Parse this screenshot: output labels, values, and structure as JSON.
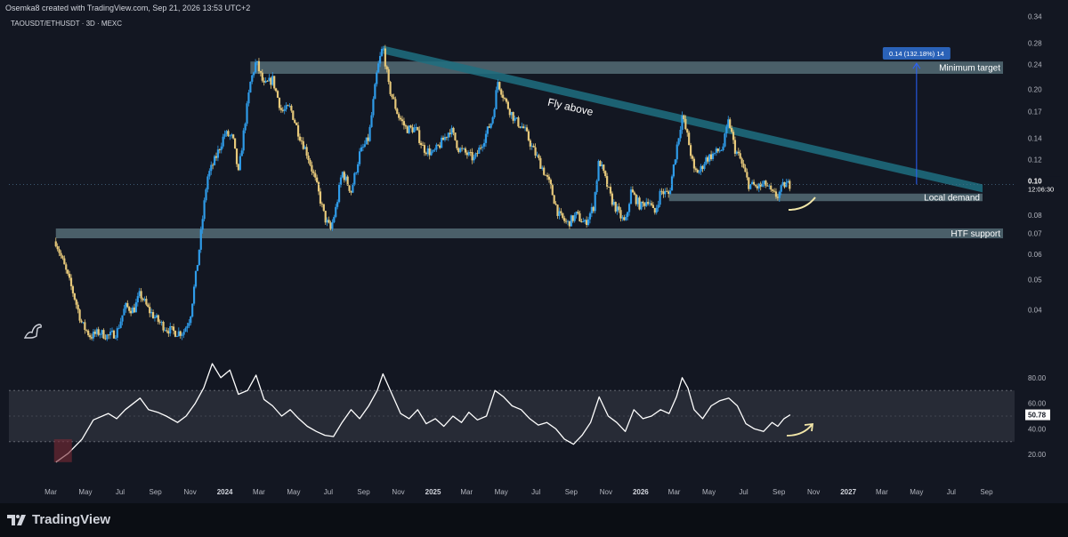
{
  "header": {
    "attribution": "Osemka8 created with TradingView.com, Sep 21, 2026 13:53 UTC+2",
    "symbol": "TAOUSDT/ETHUSDT · 3D · MEXC"
  },
  "footer": {
    "brand": "TradingView"
  },
  "colors": {
    "background": "#131722",
    "candle_up": "#2f9be8",
    "candle_down": "#e6c87a",
    "zone": "#8fb7c2",
    "trendline": "#1f6f80",
    "target_box": "#2a62b8",
    "rsi_line": "#ffffff",
    "rsi_band": "#2a2e39"
  },
  "chart_data": [
    {
      "type": "candlestick",
      "title": "TAOUSDT/ETHUSDT · 3D · MEXC",
      "x_axis_labels": [
        "Mar",
        "May",
        "Jul",
        "Sep",
        "Nov",
        "2024",
        "Mar",
        "May",
        "Jul",
        "Sep",
        "Nov",
        "2025",
        "Mar",
        "May",
        "Jul",
        "Sep",
        "Nov",
        "2026",
        "Mar",
        "May",
        "Jul",
        "Sep",
        "Nov",
        "2027",
        "Mar",
        "May",
        "Jul",
        "Sep"
      ],
      "y_axis_labels": [
        "0.34",
        "0.28",
        "0.24",
        "0.20",
        "0.17",
        "0.14",
        "0.12",
        "0.10",
        "0.08",
        "0.07",
        "0.06",
        "0.05",
        "0.04"
      ],
      "y_scale": "log",
      "ylim": [
        0.031,
        0.355
      ],
      "current_price": {
        "label": "0.10",
        "countdown": "12:06:30"
      },
      "close_path": [
        [
          "2023-03-10",
          0.066
        ],
        [
          "2023-03-25",
          0.055
        ],
        [
          "2023-04-10",
          0.045
        ],
        [
          "2023-04-25",
          0.036
        ],
        [
          "2023-05-10",
          0.033
        ],
        [
          "2023-05-25",
          0.034
        ],
        [
          "2023-06-10",
          0.033
        ],
        [
          "2023-06-25",
          0.034
        ],
        [
          "2023-07-10",
          0.041
        ],
        [
          "2023-07-25",
          0.04
        ],
        [
          "2023-08-05",
          0.045
        ],
        [
          "2023-08-20",
          0.04
        ],
        [
          "2023-09-05",
          0.037
        ],
        [
          "2023-09-20",
          0.035
        ],
        [
          "2023-10-05",
          0.034
        ],
        [
          "2023-10-20",
          0.034
        ],
        [
          "2023-11-01",
          0.038
        ],
        [
          "2023-11-15",
          0.058
        ],
        [
          "2023-12-01",
          0.105
        ],
        [
          "2023-12-15",
          0.12
        ],
        [
          "2024-01-01",
          0.145
        ],
        [
          "2024-01-15",
          0.14
        ],
        [
          "2024-01-25",
          0.108
        ],
        [
          "2024-02-05",
          0.155
        ],
        [
          "2024-02-15",
          0.21
        ],
        [
          "2024-02-25",
          0.245
        ],
        [
          "2024-03-10",
          0.205
        ],
        [
          "2024-03-25",
          0.215
        ],
        [
          "2024-04-10",
          0.17
        ],
        [
          "2024-04-25",
          0.175
        ],
        [
          "2024-05-10",
          0.145
        ],
        [
          "2024-05-25",
          0.125
        ],
        [
          "2024-06-10",
          0.1
        ],
        [
          "2024-06-25",
          0.078
        ],
        [
          "2024-07-05",
          0.072
        ],
        [
          "2024-07-15",
          0.085
        ],
        [
          "2024-07-25",
          0.11
        ],
        [
          "2024-08-10",
          0.095
        ],
        [
          "2024-08-25",
          0.125
        ],
        [
          "2024-09-10",
          0.14
        ],
        [
          "2024-09-25",
          0.23
        ],
        [
          "2024-10-05",
          0.275
        ],
        [
          "2024-10-15",
          0.205
        ],
        [
          "2024-11-01",
          0.165
        ],
        [
          "2024-11-15",
          0.15
        ],
        [
          "2024-12-01",
          0.15
        ],
        [
          "2024-12-15",
          0.13
        ],
        [
          "2025-01-01",
          0.125
        ],
        [
          "2025-01-15",
          0.135
        ],
        [
          "2025-02-01",
          0.15
        ],
        [
          "2025-02-15",
          0.13
        ],
        [
          "2025-03-01",
          0.125
        ],
        [
          "2025-03-15",
          0.12
        ],
        [
          "2025-04-01",
          0.14
        ],
        [
          "2025-04-15",
          0.16
        ],
        [
          "2025-04-25",
          0.212
        ],
        [
          "2025-05-10",
          0.18
        ],
        [
          "2025-05-25",
          0.16
        ],
        [
          "2025-06-10",
          0.15
        ],
        [
          "2025-06-25",
          0.13
        ],
        [
          "2025-07-10",
          0.115
        ],
        [
          "2025-07-25",
          0.1
        ],
        [
          "2025-08-10",
          0.08
        ],
        [
          "2025-08-25",
          0.075
        ],
        [
          "2025-09-10",
          0.08
        ],
        [
          "2025-09-25",
          0.075
        ],
        [
          "2025-10-10",
          0.085
        ],
        [
          "2025-10-20",
          0.12
        ],
        [
          "2025-10-30",
          0.105
        ],
        [
          "2025-11-10",
          0.09
        ],
        [
          "2025-11-25",
          0.08
        ],
        [
          "2025-12-05",
          0.075
        ],
        [
          "2025-12-15",
          0.095
        ],
        [
          "2026-01-01",
          0.085
        ],
        [
          "2026-01-15",
          0.09
        ],
        [
          "2026-01-25",
          0.08
        ],
        [
          "2026-02-05",
          0.095
        ],
        [
          "2026-02-20",
          0.093
        ],
        [
          "2026-03-05",
          0.13
        ],
        [
          "2026-03-15",
          0.165
        ],
        [
          "2026-03-25",
          0.14
        ],
        [
          "2026-04-05",
          0.11
        ],
        [
          "2026-04-15",
          0.11
        ],
        [
          "2026-04-25",
          0.12
        ],
        [
          "2026-05-10",
          0.125
        ],
        [
          "2026-05-25",
          0.13
        ],
        [
          "2026-06-05",
          0.16
        ],
        [
          "2026-06-15",
          0.13
        ],
        [
          "2026-06-25",
          0.12
        ],
        [
          "2026-07-10",
          0.1
        ],
        [
          "2026-07-25",
          0.098
        ],
        [
          "2026-08-10",
          0.1
        ],
        [
          "2026-08-20",
          0.093
        ],
        [
          "2026-08-30",
          0.092
        ],
        [
          "2026-09-10",
          0.1
        ],
        [
          "2026-09-21",
          0.1
        ]
      ],
      "zones": [
        {
          "label": "Minimum target",
          "from": "2024-02-15",
          "to": "2027-09-30",
          "low": 0.224,
          "high": 0.245
        },
        {
          "label": "Local demand",
          "from": "2026-02-20",
          "to": "2027-08-25",
          "low": 0.0885,
          "high": 0.0935
        },
        {
          "label": "HTF support",
          "from": "2023-03-10",
          "to": "2027-09-30",
          "low": 0.0675,
          "high": 0.0725
        }
      ],
      "trendline": {
        "label": "Fly above",
        "points": [
          [
            "2024-10-05",
            0.275
          ],
          [
            "2027-08-25",
            0.1
          ]
        ],
        "channel_width": 0.03
      },
      "target_measure": {
        "label": "0.14 (132.18%) 14",
        "date": "2027-05-01",
        "from": 0.1,
        "to": 0.245
      }
    },
    {
      "type": "line",
      "title": "",
      "y_axis_labels": [
        "80.00",
        "60.00",
        "40.00",
        "20.00"
      ],
      "ylim": [
        0,
        100
      ],
      "band": [
        30,
        70
      ],
      "current_value": "50.78",
      "series": [
        {
          "values": [
            [
              "2023-03-10",
              14
            ],
            [
              "2023-04-01",
              21
            ],
            [
              "2023-04-25",
              32
            ],
            [
              "2023-05-15",
              47
            ],
            [
              "2023-06-10",
              52
            ],
            [
              "2023-06-25",
              48
            ],
            [
              "2023-07-10",
              55
            ],
            [
              "2023-08-05",
              64
            ],
            [
              "2023-08-20",
              55
            ],
            [
              "2023-09-05",
              53
            ],
            [
              "2023-09-20",
              50
            ],
            [
              "2023-10-10",
              45
            ],
            [
              "2023-10-25",
              50
            ],
            [
              "2023-11-10",
              60
            ],
            [
              "2023-11-25",
              72
            ],
            [
              "2023-12-10",
              91
            ],
            [
              "2023-12-25",
              80
            ],
            [
              "2024-01-10",
              86
            ],
            [
              "2024-01-25",
              67
            ],
            [
              "2024-02-10",
              70
            ],
            [
              "2024-02-25",
              82
            ],
            [
              "2024-03-10",
              63
            ],
            [
              "2024-03-25",
              58
            ],
            [
              "2024-04-10",
              50
            ],
            [
              "2024-04-25",
              55
            ],
            [
              "2024-05-10",
              48
            ],
            [
              "2024-05-25",
              42
            ],
            [
              "2024-06-10",
              38
            ],
            [
              "2024-06-25",
              35
            ],
            [
              "2024-07-10",
              34
            ],
            [
              "2024-07-25",
              45
            ],
            [
              "2024-08-10",
              55
            ],
            [
              "2024-08-25",
              48
            ],
            [
              "2024-09-10",
              58
            ],
            [
              "2024-09-25",
              70
            ],
            [
              "2024-10-05",
              83
            ],
            [
              "2024-10-20",
              68
            ],
            [
              "2024-11-05",
              52
            ],
            [
              "2024-11-20",
              48
            ],
            [
              "2024-12-05",
              55
            ],
            [
              "2024-12-20",
              44
            ],
            [
              "2025-01-05",
              48
            ],
            [
              "2025-01-20",
              42
            ],
            [
              "2025-02-05",
              50
            ],
            [
              "2025-02-20",
              45
            ],
            [
              "2025-03-05",
              53
            ],
            [
              "2025-03-20",
              47
            ],
            [
              "2025-04-05",
              50
            ],
            [
              "2025-04-20",
              70
            ],
            [
              "2025-05-05",
              65
            ],
            [
              "2025-05-20",
              58
            ],
            [
              "2025-06-05",
              55
            ],
            [
              "2025-06-20",
              48
            ],
            [
              "2025-07-05",
              43
            ],
            [
              "2025-07-20",
              45
            ],
            [
              "2025-08-05",
              40
            ],
            [
              "2025-08-20",
              32
            ],
            [
              "2025-09-05",
              28
            ],
            [
              "2025-09-20",
              35
            ],
            [
              "2025-10-05",
              45
            ],
            [
              "2025-10-20",
              65
            ],
            [
              "2025-11-05",
              50
            ],
            [
              "2025-11-20",
              45
            ],
            [
              "2025-12-05",
              38
            ],
            [
              "2025-12-20",
              55
            ],
            [
              "2026-01-05",
              48
            ],
            [
              "2026-01-20",
              50
            ],
            [
              "2026-02-05",
              55
            ],
            [
              "2026-02-20",
              52
            ],
            [
              "2026-03-05",
              65
            ],
            [
              "2026-03-15",
              80
            ],
            [
              "2026-03-25",
              72
            ],
            [
              "2026-04-05",
              55
            ],
            [
              "2026-04-20",
              48
            ],
            [
              "2026-05-05",
              58
            ],
            [
              "2026-05-20",
              62
            ],
            [
              "2026-06-05",
              64
            ],
            [
              "2026-06-20",
              58
            ],
            [
              "2026-07-05",
              44
            ],
            [
              "2026-07-20",
              40
            ],
            [
              "2026-08-05",
              38
            ],
            [
              "2026-08-20",
              45
            ],
            [
              "2026-08-30",
              42
            ],
            [
              "2026-09-10",
              48
            ],
            [
              "2026-09-21",
              51
            ]
          ]
        }
      ]
    }
  ]
}
